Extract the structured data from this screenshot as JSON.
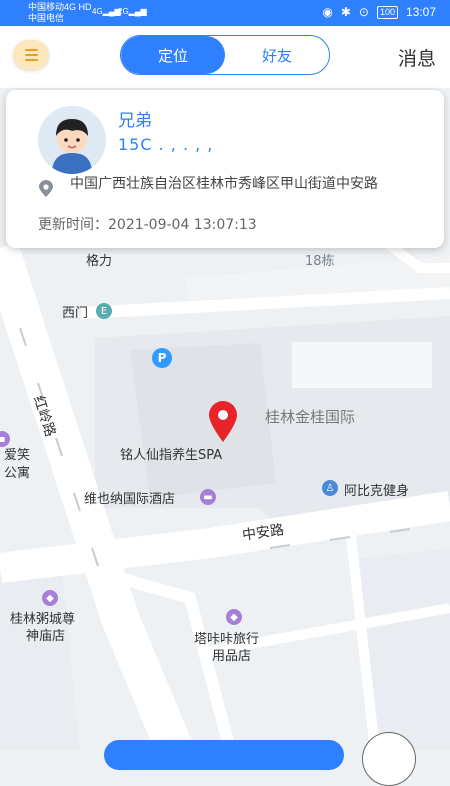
{
  "status_bar": {
    "carrier_1": "中国移动4G",
    "carrier_1_badge": "HD",
    "carrier_2": "中国电信",
    "signal_1": "4G",
    "signal_2": "2G",
    "battery": "100",
    "time": "13:07"
  },
  "nav": {
    "tabs": [
      {
        "label": "定位",
        "active": true
      },
      {
        "label": "好友",
        "active": false
      }
    ],
    "messages_label": "消息"
  },
  "card": {
    "name": "兄弟",
    "phone": "15C . ,  . ,  ,",
    "address": "中国广西壮族自治区桂林市秀峰区甲山街道中安路",
    "updated_label": "更新时间：",
    "updated_value": "2021-09-04 13:07:13"
  },
  "map": {
    "labels": {
      "geli": "格力",
      "bldg18": "18栋",
      "ximen": "西门",
      "honglinglu": "红岭路",
      "jingui": "桂林金桂国际",
      "spa": "铭人仙指养生SPA",
      "hotel": "维也纳国际酒店",
      "gym": "阿比克健身",
      "zhonganlu": "中安路",
      "aixiao_1": "爱笑",
      "aixiao_2": "公寓",
      "zhoucheng_1": "桂林粥城尊",
      "zhoucheng_2": "神庙店",
      "taka_1": "塔咔咔旅行",
      "taka_2": "用品店",
      "parking": "P"
    },
    "colors": {
      "pin": "#e8232a",
      "poi_purple": "#a77fd6",
      "poi_blue": "#4a8bd6",
      "poi_teal": "#5aaab0",
      "parking": "#2f9bff"
    }
  },
  "colors": {
    "accent": "#2f80ff",
    "menu_bg": "#fde7bd",
    "menu_lines": "#e5a21f"
  }
}
